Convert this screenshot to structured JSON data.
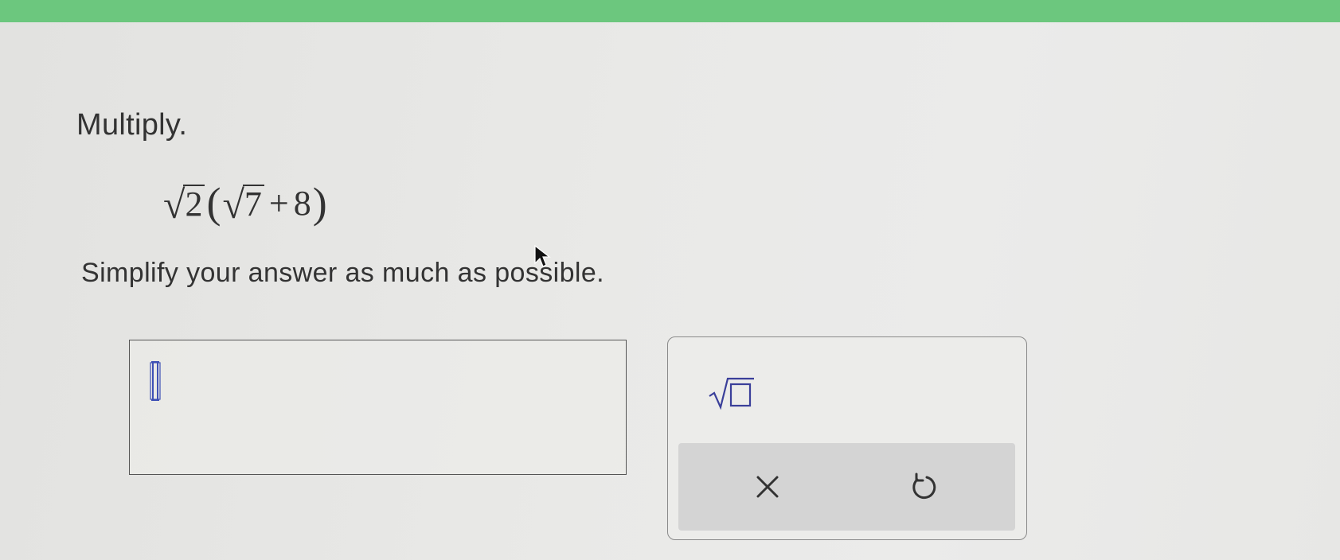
{
  "colors": {
    "header_bar": "#6cc77e",
    "page_bg": "#e8e8e6",
    "text": "#333333",
    "caret": "#3f51b5",
    "keypad_row": "#d4d4d4"
  },
  "problem": {
    "instruction": "Multiply.",
    "expression": {
      "outer_radicand": "2",
      "open_paren": "(",
      "inner_radicand": "7",
      "operator": "+",
      "constant": "8",
      "close_paren": ")"
    },
    "prompt": "Simplify your answer as much as possible."
  },
  "answer": {
    "value": ""
  },
  "keypad": {
    "buttons": [
      {
        "name": "square-root",
        "icon": "sqrt-template-icon"
      },
      {
        "name": "clear",
        "icon": "close-icon"
      },
      {
        "name": "undo",
        "icon": "undo-icon"
      }
    ]
  }
}
